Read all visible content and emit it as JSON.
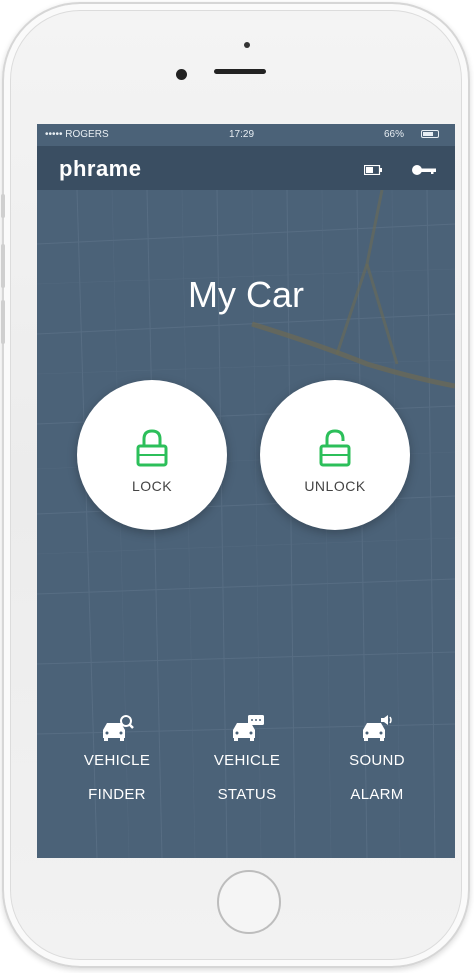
{
  "status_bar": {
    "carrier": "••••• ROGERS",
    "time": "17:29",
    "battery": "66%"
  },
  "app": {
    "logo": "phrame"
  },
  "main": {
    "title": "My Car",
    "lock_label": "LOCK",
    "unlock_label": "UNLOCK"
  },
  "actions": [
    {
      "line1": "VEHICLE",
      "line2": "FINDER",
      "icon": "car-search-icon"
    },
    {
      "line1": "VEHICLE",
      "line2": "STATUS",
      "icon": "car-message-icon"
    },
    {
      "line1": "SOUND",
      "line2": "ALARM",
      "icon": "car-sound-icon"
    }
  ],
  "colors": {
    "accent_green": "#2cbf5a",
    "appbar": "#3a4e62",
    "screen_bg": "#4a6177"
  }
}
